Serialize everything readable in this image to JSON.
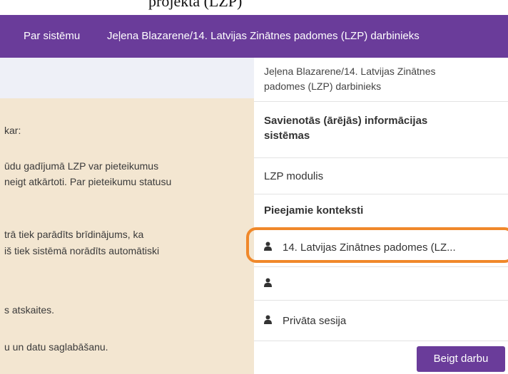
{
  "top": {
    "caption_fragment": "projektā (LZP)"
  },
  "navbar": {
    "about_label": "Par sistēmu",
    "user_label": "Jeļena Blazarene/14. Latvijas Zinātnes padomes (LZP) darbinieks"
  },
  "left": {
    "lines": [
      "kar:",
      "ūdu gadījumā LZP var pieteikumus",
      "neigt atkārtoti. Par pieteikumu statusu",
      "trā tiek parādīts brīdinājums, ka",
      "iš tiek sistēmā norādīts automātiski",
      "s atskaites.",
      "u un datu saglabāšanu."
    ]
  },
  "menu": {
    "user_line1": "Jeļena Blazarene/14. Latvijas Zinātnes",
    "user_line2": "padomes (LZP) darbinieks",
    "external_line1": "Savienotās (ārējās) informācijas",
    "external_line2": "sistēmas",
    "lzp_module": "LZP modulis",
    "contexts_heading": "Pieejamie konteksti",
    "contexts": [
      {
        "icon": "user-icon",
        "label": "14. Latvijas Zinātnes padomes (LZ..."
      },
      {
        "icon": "user-icon",
        "label": ""
      },
      {
        "icon": "user-icon",
        "label": "Privāta sesija"
      }
    ],
    "end_button": "Beigt darbu"
  },
  "colors": {
    "navbar": "#6a3c9a",
    "highlight": "#f0882a",
    "left_bg": "#f3e6d1"
  }
}
